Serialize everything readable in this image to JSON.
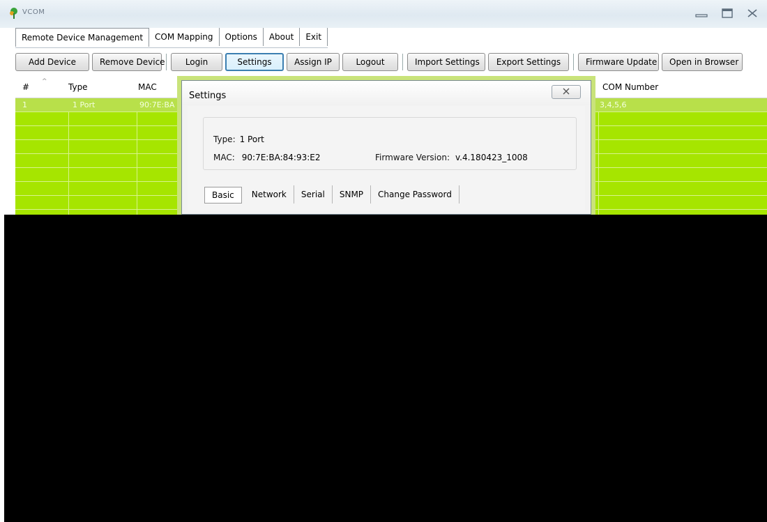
{
  "window": {
    "title": "VCOM",
    "icon": "app-leaf-icon",
    "controls": [
      "minimize-icon",
      "maximize-icon",
      "close-icon"
    ]
  },
  "menu": {
    "items": [
      {
        "label": "Remote Device Management",
        "active": true
      },
      {
        "label": "COM Mapping",
        "active": false
      },
      {
        "label": "Options",
        "active": false
      },
      {
        "label": "About",
        "active": false
      },
      {
        "label": "Exit",
        "active": false
      }
    ]
  },
  "toolbar": {
    "add_device": "Add Device",
    "remove_device": "Remove Device",
    "login": "Login",
    "settings": "Settings",
    "assign_ip": "Assign IP",
    "logout": "Logout",
    "import_settings": "Import Settings",
    "export_settings": "Export Settings",
    "firmware_update": "Firmware Update",
    "open_in_browser": "Open in Browser"
  },
  "grid": {
    "columns": {
      "number": "#",
      "type": "Type",
      "mac": "MAC",
      "com": "COM Number"
    },
    "rows": [
      {
        "number": "1",
        "type": "1 Port",
        "mac": "90:7E:BA",
        "com": "3,4,5,6"
      }
    ],
    "row_color": "#a6e500",
    "selected_row_color": "#b8e04a"
  },
  "dialog": {
    "title": "Settings",
    "type_label": "Type:",
    "type_value": "1 Port",
    "mac_label": "MAC:",
    "mac_value": "90:7E:BA:84:93:E2",
    "firmware_label": "Firmware Version:",
    "firmware_value": "v.4.180423_1008",
    "tabs": [
      {
        "label": "Basic",
        "active": true
      },
      {
        "label": "Network",
        "active": false
      },
      {
        "label": "Serial",
        "active": false
      },
      {
        "label": "SNMP",
        "active": false
      },
      {
        "label": "Change Password",
        "active": false
      }
    ]
  }
}
